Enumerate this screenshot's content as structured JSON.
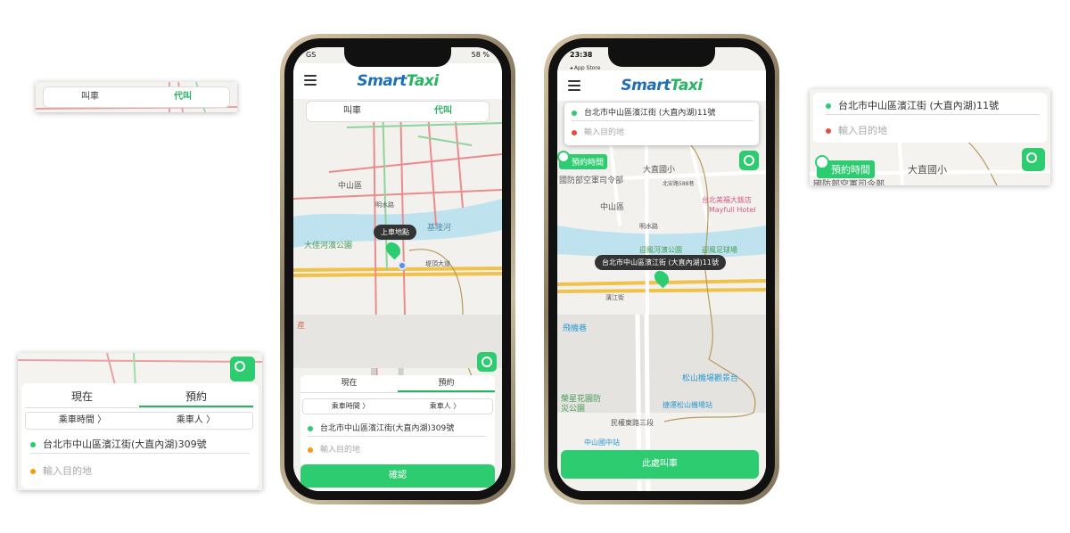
{
  "brand": {
    "logo_smart": "Smart",
    "logo_taxi": "Taxi",
    "primary": "#2ecc71",
    "accent_blue": "#1f6fb5"
  },
  "crop_top_left": {
    "tab_call": "叫車",
    "tab_proxy": "代叫"
  },
  "crop_bottom_left": {
    "tab_now": "現在",
    "tab_reserve": "預約",
    "time_label": "乘車時間 〉",
    "rider_label": "乘車人 〉",
    "pickup": "台北市中山區濱江街(大直內湖)309號",
    "destination_placeholder": "輸入目的地"
  },
  "phone1": {
    "status_left": "GS",
    "status_right": "58 %",
    "tab_call": "叫車",
    "tab_proxy": "代叫",
    "map_labels": {
      "zhongshan": "中山區",
      "mingshui": "明水路",
      "keelung": "基隆河",
      "park": "大佳河濱公園",
      "road": "堤頂大道",
      "prod": "產"
    },
    "pin_label": "上車地點",
    "tab_now": "現在",
    "tab_reserve": "預約",
    "time_label": "乘車時間 〉",
    "rider_label": "乘車人 〉",
    "pickup": "台北市中山區濱江街(大直內湖)309號",
    "destination_placeholder": "輸入目的地",
    "confirm": "確認"
  },
  "phone2": {
    "status_time": "23:38",
    "status_back": "◂ App Store",
    "pickup": "台北市中山區濱江街 (大直內湖)11號",
    "destination_placeholder": "輸入目的地",
    "reserve_badge": "預約時間",
    "map_labels": {
      "defense": "國防部空軍司令部",
      "school": "大直國小",
      "store": "北安路588巷",
      "zhongshan": "中山區",
      "mayfull_cn": "台北美福大飯店",
      "mayfull_en": "Mayfull Hotel",
      "mingshui": "明水路",
      "park": "迎風河濱公園",
      "field": "迎風足球場",
      "shuttle": "濱江街",
      "airport_view": "松山機場觀景台",
      "mrt": "捷運松山機場站",
      "garden": "榮星花園防災公園",
      "plane": "飛機巷",
      "minquan": "民權東路三段",
      "zhongshan_junior": "中山國中站"
    },
    "pin_label": "台北市中山區濱江街 (大直內湖)11號",
    "call_here": "此處叫車"
  },
  "crop_right": {
    "pickup": "台北市中山區濱江街 (大直內湖)11號",
    "destination_placeholder": "輸入目的地",
    "reserve_badge": "預約時間",
    "school": "大直國小",
    "defense": "國防部空軍司令部"
  }
}
